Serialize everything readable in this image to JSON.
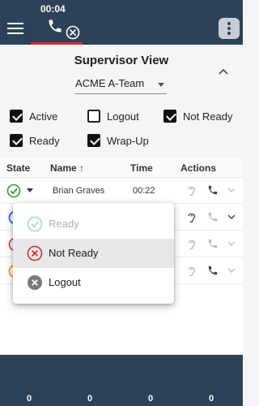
{
  "header": {
    "call_timer": "00:04",
    "colors": {
      "bar": "#2d4258",
      "alert": "#d32f2f"
    },
    "icons": [
      "menu-icon",
      "phone-icon",
      "close-circle-icon",
      "more-vertical-icon"
    ]
  },
  "supervisor": {
    "title": "Supervisor View",
    "team": "ACME A-Team"
  },
  "filters": [
    {
      "label": "Active",
      "checked": true
    },
    {
      "label": "Logout",
      "checked": false
    },
    {
      "label": "Not Ready",
      "checked": true
    },
    {
      "label": "Ready",
      "checked": true
    },
    {
      "label": "Wrap-Up",
      "checked": true
    }
  ],
  "table": {
    "columns": {
      "state": "State",
      "name": "Name",
      "name_sort": "↑",
      "time": "Time",
      "actions": "Actions"
    },
    "rows": [
      {
        "state": "ready",
        "name": "Brian Graves",
        "time": "00:22"
      },
      {
        "state": "active",
        "name": "",
        "time": ""
      },
      {
        "state": "not-ready",
        "name": "",
        "time": ""
      },
      {
        "state": "wrap-up",
        "name": "",
        "time": ""
      }
    ]
  },
  "state_menu": {
    "items": [
      {
        "label": "Ready",
        "disabled": true,
        "selected": false
      },
      {
        "label": "Not Ready",
        "disabled": false,
        "selected": true
      },
      {
        "label": "Logout",
        "disabled": false,
        "selected": false
      }
    ]
  },
  "footer": {
    "counts": [
      "0",
      "0",
      "0",
      "0"
    ]
  }
}
